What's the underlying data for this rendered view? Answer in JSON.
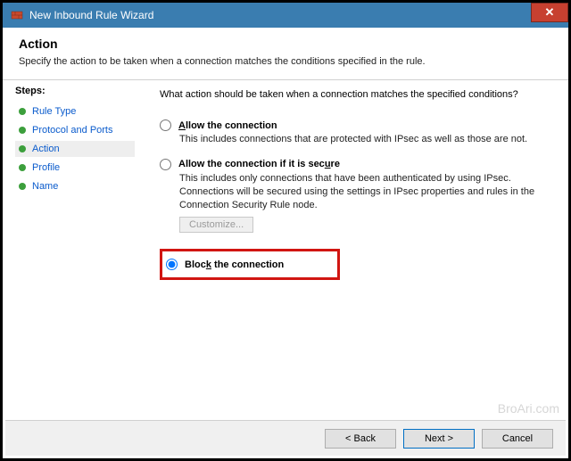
{
  "window": {
    "title": "New Inbound Rule Wizard"
  },
  "header": {
    "title": "Action",
    "desc": "Specify the action to be taken when a connection matches the conditions specified in the rule."
  },
  "sidebar": {
    "heading": "Steps:",
    "items": [
      {
        "label": "Rule Type"
      },
      {
        "label": "Protocol and Ports"
      },
      {
        "label": "Action"
      },
      {
        "label": "Profile"
      },
      {
        "label": "Name"
      }
    ],
    "selected_index": 2
  },
  "main": {
    "question": "What action should be taken when a connection matches the specified conditions?",
    "options": {
      "allow": {
        "label_pre": "",
        "label_u": "A",
        "label_post": "llow the connection",
        "desc": "This includes connections that are protected with IPsec as well as those are not."
      },
      "allow_secure": {
        "label_pre": "Allow the connection if it is sec",
        "label_u": "u",
        "label_post": "re",
        "desc": "This includes only connections that have been authenticated by using IPsec. Connections will be secured using the settings in IPsec properties and rules in the Connection Security Rule node.",
        "customize": "Customize..."
      },
      "block": {
        "label_pre": "Bloc",
        "label_u": "k",
        "label_post": " the connection"
      }
    }
  },
  "footer": {
    "back": "< Back",
    "next": "Next >",
    "cancel": "Cancel"
  },
  "watermark": "BroAri.com"
}
